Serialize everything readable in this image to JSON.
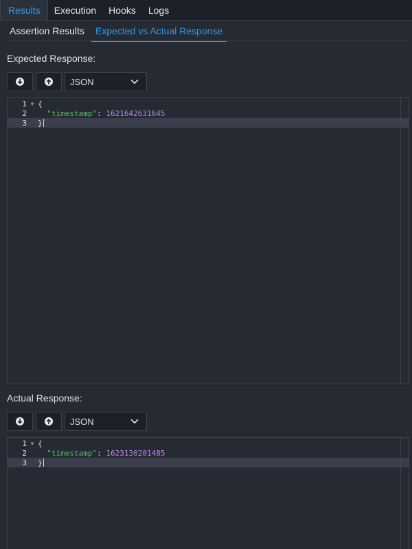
{
  "top_tabs": [
    {
      "label": "Results",
      "active": true
    },
    {
      "label": "Execution",
      "active": false
    },
    {
      "label": "Hooks",
      "active": false
    },
    {
      "label": "Logs",
      "active": false
    }
  ],
  "sub_tabs": [
    {
      "label": "Assertion Results",
      "active": false
    },
    {
      "label": "Expected vs Actual Response",
      "active": true
    }
  ],
  "expected": {
    "label": "Expected Response:",
    "format": "JSON",
    "lines": [
      {
        "num": "1",
        "open": "{"
      },
      {
        "num": "2",
        "key": "\"timestamp\"",
        "sep": ": ",
        "value": "1621642631645"
      },
      {
        "num": "3",
        "close": "}"
      }
    ]
  },
  "actual": {
    "label": "Actual Response:",
    "format": "JSON",
    "lines": [
      {
        "num": "1",
        "open": "{"
      },
      {
        "num": "2",
        "key": "\"timestamp\"",
        "sep": ": ",
        "value": "1623130201485"
      },
      {
        "num": "3",
        "close": "}"
      }
    ]
  },
  "icons": {
    "download": "arrow-down-circle-icon",
    "upload": "arrow-up-circle-icon",
    "dropdown": "chevron-down-icon",
    "fold": "fold-triangle-icon"
  },
  "colors": {
    "accent": "#2a9df4",
    "json_key": "#56c25b",
    "json_number": "#b48ae6",
    "background": "#252a33"
  }
}
